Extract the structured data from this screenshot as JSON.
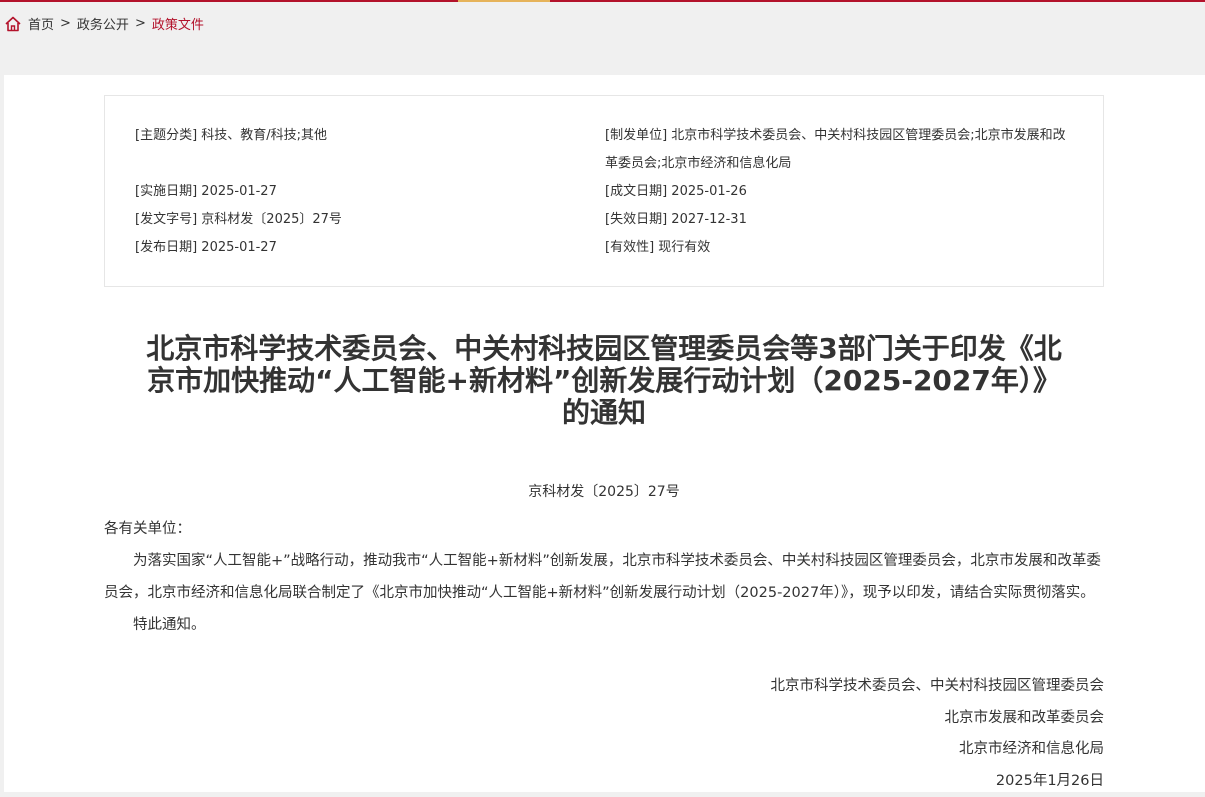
{
  "breadcrumb": {
    "home": "首页",
    "sep": ">",
    "level1": "政务公开",
    "current": "政策文件"
  },
  "meta": {
    "topic_label": "[主题分类]",
    "topic_value": "科技、教育/科技;其他",
    "issuer_label": "[制发单位]",
    "issuer_value": "北京市科学技术委员会、中关村科技园区管理委员会;北京市发展和改革委员会;北京市经济和信息化局",
    "effective_label": "[实施日期]",
    "effective_value": "2025-01-27",
    "created_label": "[成文日期]",
    "created_value": "2025-01-26",
    "docno_label": "[发文字号]",
    "docno_value": "京科材发〔2025〕27号",
    "expire_label": "[失效日期]",
    "expire_value": "2027-12-31",
    "publish_label": "[发布日期]",
    "publish_value": "2025-01-27",
    "validity_label": "[有效性]",
    "validity_value": "现行有效"
  },
  "document": {
    "title": "北京市科学技术委员会、中关村科技园区管理委员会等3部门关于印发《北京市加快推动“人工智能+新材料”创新发展行动计划（2025-2027年）》的通知",
    "number": "京科材发〔2025〕27号",
    "salutation": "各有关单位：",
    "paragraph1": "为落实国家“人工智能+”战略行动，推动我市“人工智能+新材料”创新发展，北京市科学技术委员会、中关村科技园区管理委员会，北京市发展和改革委员会，北京市经济和信息化局联合制定了《北京市加快推动“人工智能+新材料”创新发展行动计划（2025-2027年）》，现予以印发，请结合实际贯彻落实。",
    "paragraph2": "特此通知。",
    "signer1": "北京市科学技术委员会、中关村科技园区管理委员会",
    "signer2": "北京市发展和改革委员会",
    "signer3": "北京市经济和信息化局",
    "date": "2025年1月26日"
  },
  "colors": {
    "accent": "#b3122b",
    "highlight": "#e6b35a"
  },
  "icons": {
    "home": "home-icon"
  }
}
